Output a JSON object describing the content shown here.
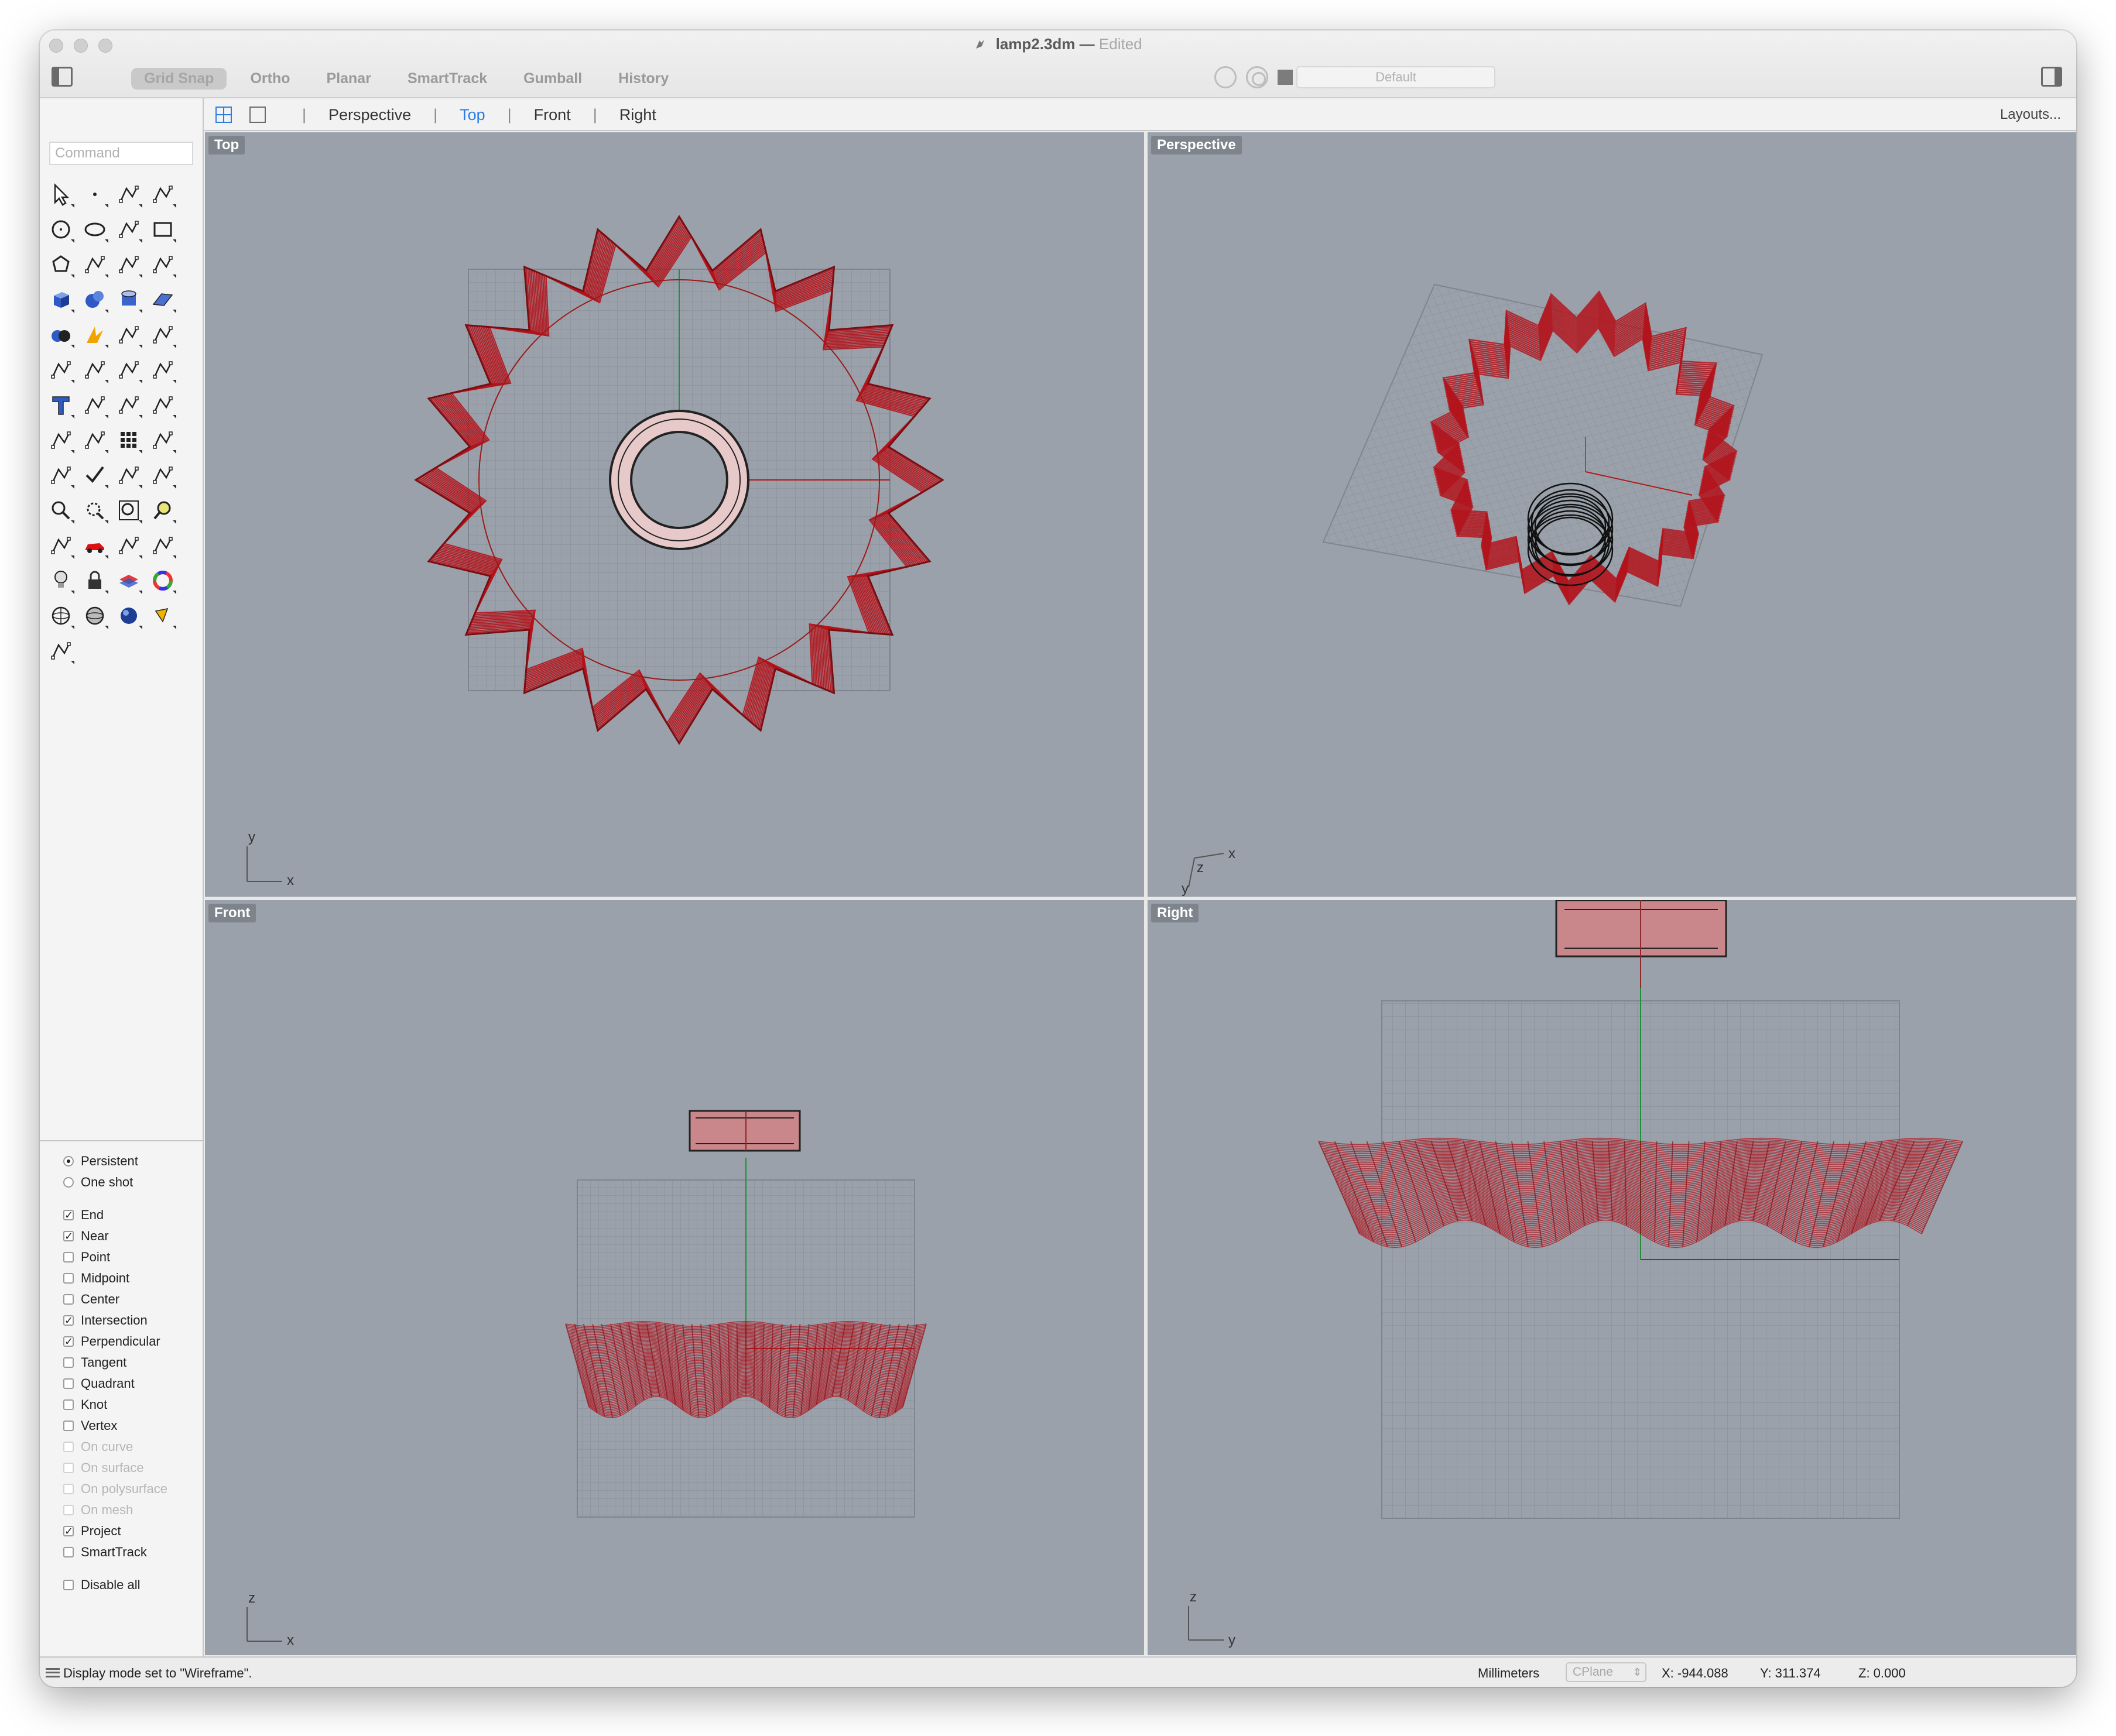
{
  "window": {
    "title": "lamp2.3dm",
    "title_separator": "—",
    "edited_label": "Edited"
  },
  "toolbar": {
    "modes": [
      {
        "label": "Grid Snap",
        "active": true
      },
      {
        "label": "Ortho",
        "active": false
      },
      {
        "label": "Planar",
        "active": false
      },
      {
        "label": "SmartTrack",
        "active": false
      },
      {
        "label": "Gumball",
        "active": false
      },
      {
        "label": "History",
        "active": false
      }
    ],
    "layer_name": "Default",
    "layer_color": "#7c7c7c"
  },
  "tabbar": {
    "tabs": [
      "Perspective",
      "Top",
      "Front",
      "Right"
    ],
    "active_tab": "Top",
    "layouts_label": "Layouts..."
  },
  "command": {
    "placeholder": "Command"
  },
  "tool_icons": [
    "select-arrow-icon",
    "point-icon",
    "polyline-icon",
    "curve-control-points-icon",
    "circle-icon",
    "ellipse-icon",
    "arc-icon",
    "rectangle-icon",
    "polygon-icon",
    "fillet-curve-icon",
    "surface-from-points-icon",
    "extrude-curve-icon",
    "box-solid-icon",
    "sphere-solid-icon",
    "cylinder-solid-icon",
    "planar-surface-icon",
    "boolean-icon",
    "explode-icon",
    "trim-icon",
    "split-icon",
    "join-icon",
    "group-icon",
    "offset-icon",
    "blend-curve-icon",
    "text-icon",
    "dimension-icon",
    "block-icon",
    "hatch-icon",
    "box-edit-icon",
    "move-icon",
    "array-icon",
    "align-icon",
    "transform-icon",
    "check-icon",
    "analyze-icon",
    "surface-analysis-icon",
    "zoom-icon",
    "zoom-window-icon",
    "zoom-extents-icon",
    "zoom-selected-icon",
    "rotate-view-icon",
    "car-render-icon",
    "map-texture-icon",
    "named-view-icon",
    "light-icon",
    "lock-icon",
    "layer-icon",
    "color-wheel-icon",
    "wireframe-sphere-icon",
    "shaded-sphere-icon",
    "render-sphere-icon",
    "paint-bucket-icon",
    "cplane-icon"
  ],
  "osnap": {
    "modes": [
      {
        "label": "Persistent",
        "selected": true
      },
      {
        "label": "One shot",
        "selected": false
      }
    ],
    "items": [
      {
        "label": "End",
        "checked": true,
        "enabled": true
      },
      {
        "label": "Near",
        "checked": true,
        "enabled": true
      },
      {
        "label": "Point",
        "checked": false,
        "enabled": true
      },
      {
        "label": "Midpoint",
        "checked": false,
        "enabled": true
      },
      {
        "label": "Center",
        "checked": false,
        "enabled": true
      },
      {
        "label": "Intersection",
        "checked": true,
        "enabled": true
      },
      {
        "label": "Perpendicular",
        "checked": true,
        "enabled": true
      },
      {
        "label": "Tangent",
        "checked": false,
        "enabled": true
      },
      {
        "label": "Quadrant",
        "checked": false,
        "enabled": true
      },
      {
        "label": "Knot",
        "checked": false,
        "enabled": true
      },
      {
        "label": "Vertex",
        "checked": false,
        "enabled": true
      },
      {
        "label": "On curve",
        "checked": false,
        "enabled": false
      },
      {
        "label": "On surface",
        "checked": false,
        "enabled": false
      },
      {
        "label": "On polysurface",
        "checked": false,
        "enabled": false
      },
      {
        "label": "On mesh",
        "checked": false,
        "enabled": false
      },
      {
        "label": "Project",
        "checked": true,
        "enabled": true
      },
      {
        "label": "SmartTrack",
        "checked": false,
        "enabled": true
      }
    ],
    "disable_all_label": "Disable all"
  },
  "viewports": {
    "top": {
      "label": "Top",
      "axis_a": "y",
      "axis_b": "x"
    },
    "perspective": {
      "label": "Perspective",
      "axis_a": "z",
      "axis_b": "x",
      "axis_c": "y"
    },
    "front": {
      "label": "Front",
      "axis_a": "z",
      "axis_b": "x"
    },
    "right": {
      "label": "Right",
      "axis_a": "z",
      "axis_b": "y"
    }
  },
  "colors": {
    "viewport_bg": "#9aa1aa",
    "model_red": "#b3141c",
    "accent_blue": "#2b7ce9"
  },
  "status": {
    "message": "Display mode set to \"Wireframe\".",
    "units": "Millimeters",
    "cplane": "CPlane",
    "x": "X: -944.088",
    "y": "Y: 311.374",
    "z": "Z: 0.000"
  }
}
